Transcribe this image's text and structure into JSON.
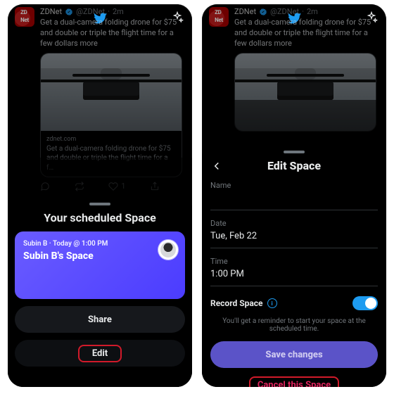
{
  "colors": {
    "accent": "#1d9bf0",
    "danger": "#e0245e",
    "save": "#5b53c8"
  },
  "tweet": {
    "author": "ZDNet",
    "handle": "@ZDNet",
    "time": "2m",
    "text": "Get a dual-camera folding drone for $75 and double or triple the flight time for a few dollars more",
    "card_domain": "zdnet.com",
    "card_title": "Get a dual-camera folding drone for $75 and double or triple the flight time for a f…",
    "like_count": "1"
  },
  "left": {
    "sheet_title": "Your scheduled Space",
    "card_subtitle": "Subin B · Today @ 1:00 PM",
    "card_title": "Subin B's Space",
    "share_label": "Share",
    "edit_label": "Edit"
  },
  "right": {
    "title": "Edit Space",
    "name_label": "Name",
    "name_value": "",
    "date_label": "Date",
    "date_value": "Tue, Feb 22",
    "time_label": "Time",
    "time_value": "1:00 PM",
    "record_label": "Record Space",
    "record_on": true,
    "hint": "You'll get a reminder to start your space at the scheduled time.",
    "save_label": "Save changes",
    "cancel_label": "Cancel this Space"
  }
}
